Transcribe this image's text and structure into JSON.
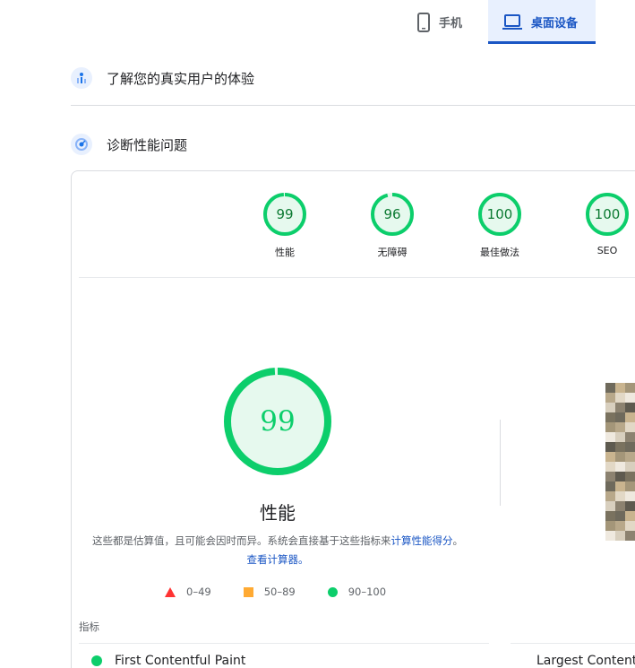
{
  "tabs": {
    "mobile_label": "手机",
    "desktop_label": "桌面设备"
  },
  "sections": {
    "real_users": "了解您的真实用户的体验",
    "diagnose": "诊断性能问题"
  },
  "gauges": [
    {
      "score": "99",
      "label": "性能",
      "fraction": 0.99
    },
    {
      "score": "96",
      "label": "无障碍",
      "fraction": 0.96
    },
    {
      "score": "100",
      "label": "最佳做法",
      "fraction": 1.0
    },
    {
      "score": "100",
      "label": "SEO",
      "fraction": 1.0
    }
  ],
  "performance": {
    "score": "99",
    "fraction": 0.99,
    "label": "性能",
    "desc_text": "这些都是估算值，且可能会因时而异。系统会直接基于这些指标来",
    "desc_link1": "计算性能得分",
    "desc_sep": "。",
    "desc_link2": "查看计算器。"
  },
  "legend": [
    {
      "range": "0–49",
      "color": "#ff3333"
    },
    {
      "range": "50–89",
      "color": "#ffaa33"
    },
    {
      "range": "90–100",
      "color": "#0cce6b"
    }
  ],
  "metrics": {
    "title": "指标",
    "items": [
      "First Contentful Paint",
      "Largest Contentful Paint"
    ]
  },
  "colors": {
    "good": "#0cce6b",
    "good_text": "#0c7a32",
    "accent": "#1a56c4"
  }
}
